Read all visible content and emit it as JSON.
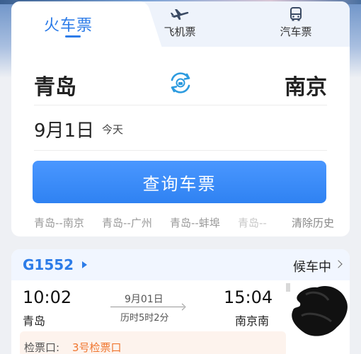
{
  "tabs": {
    "train": "火车票",
    "plane": "飞机票",
    "bus": "汽车票"
  },
  "route": {
    "from": "青岛",
    "to": "南京",
    "swap_icon": "swap-icon"
  },
  "date": {
    "main": "9月1日",
    "sub": "今天"
  },
  "search_button": "查询车票",
  "history": {
    "items": [
      "青岛--南京",
      "青岛--广州",
      "青岛--蚌埠",
      "青岛--"
    ],
    "clear": "清除历史"
  },
  "trip": {
    "train_no": "G1552",
    "status": "候车中",
    "depart_time": "10:02",
    "depart_station": "青岛",
    "arrive_time": "15:04",
    "arrive_station": "南京南",
    "date": "9月01日",
    "duration": "历时5时2分",
    "gate_label": "检票口:",
    "gate_value": "3号检票口"
  },
  "colors": {
    "accent": "#2d7ce8",
    "gate": "#f0762f"
  }
}
